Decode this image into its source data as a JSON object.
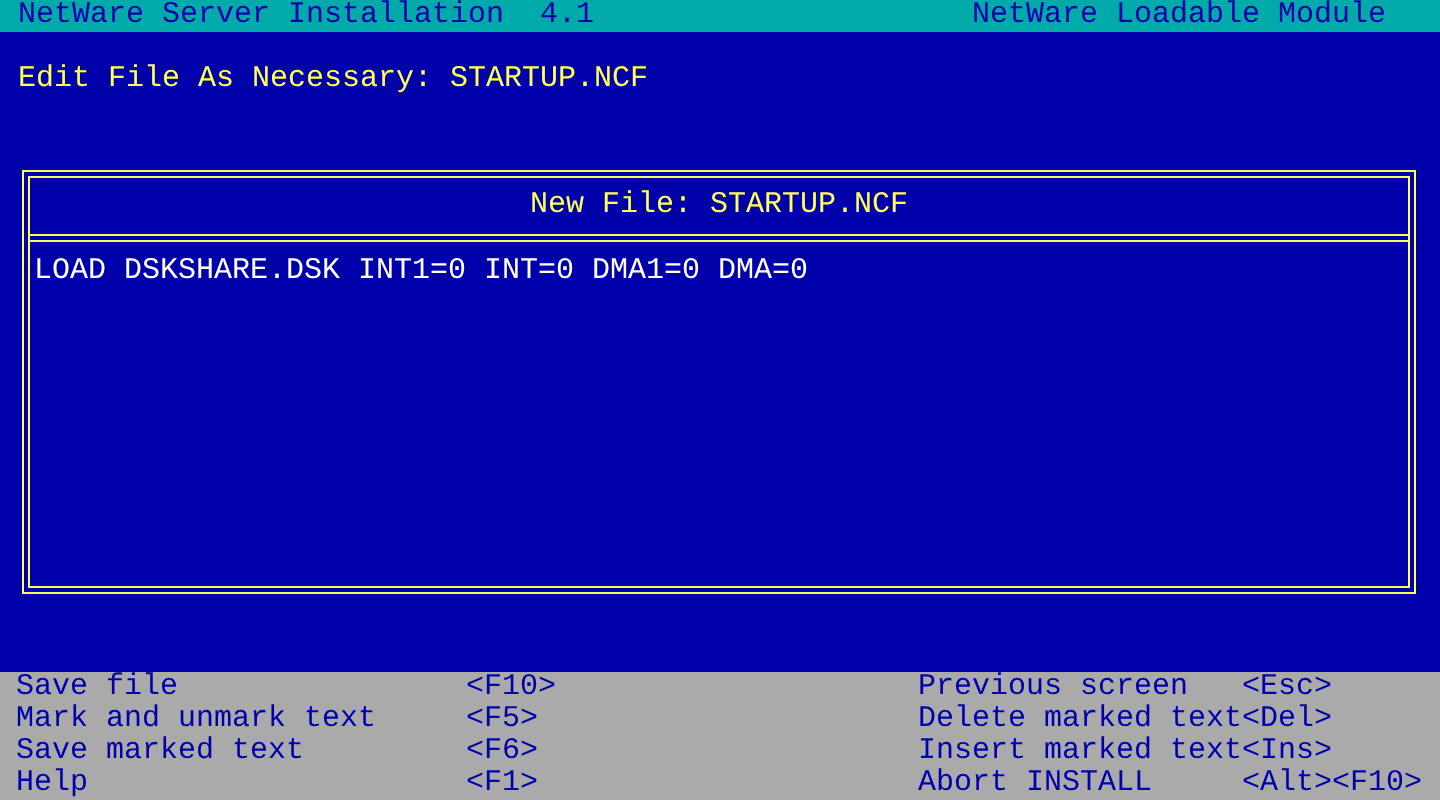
{
  "header": {
    "title": "NetWare Server Installation  4.1",
    "module": "NetWare Loadable Module"
  },
  "prompt": "Edit File As Necessary: STARTUP.NCF",
  "editor": {
    "title": "New File: STARTUP.NCF",
    "lines": [
      "LOAD DSKSHARE.DSK INT1=0 INT=0 DMA1=0 DMA=0"
    ]
  },
  "help_keys": {
    "left": [
      {
        "label": "Save file",
        "key": "<F10>"
      },
      {
        "label": "Mark and unmark text",
        "key": "<F5>"
      },
      {
        "label": "Save marked text",
        "key": "<F6>"
      },
      {
        "label": "Help",
        "key": "<F1>"
      }
    ],
    "right": [
      {
        "label": "Previous screen",
        "key": "<Esc>"
      },
      {
        "label": "Delete marked text",
        "key": "<Del>"
      },
      {
        "label": "Insert marked text",
        "key": "<Ins>"
      },
      {
        "label": "Abort INSTALL",
        "key": "<Alt><F10>"
      }
    ]
  }
}
